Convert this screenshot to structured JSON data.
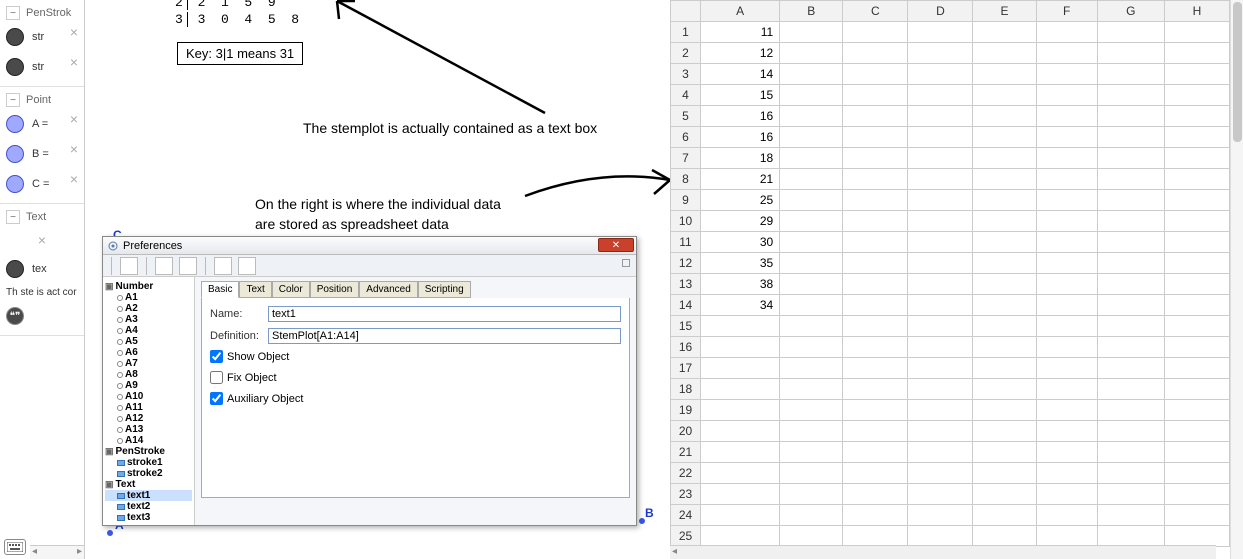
{
  "left_panel": {
    "sections": {
      "penstroke": {
        "label": "PenStrok"
      },
      "point": {
        "label": "Point"
      },
      "text": {
        "label": "Text"
      }
    },
    "items": {
      "stroke1": "str",
      "stroke2": "str",
      "pointA": "A =",
      "pointB": "B =",
      "pointC": "C =",
      "text1": "tex",
      "wrapped": "Th\nste\nis\nact\ncor"
    }
  },
  "canvas": {
    "stemplot": {
      "row2": "2  1  5  9",
      "row3": "3  0  4  5  8",
      "key": "Key: 3|1 means 31"
    },
    "annot1": "The stemplot is actually contained as a text box",
    "annot2_l1": "On the right is where the individual data",
    "annot2_l2": "are stored as spreadsheet data",
    "points": {
      "C": "C",
      "B": "B",
      "A": "A"
    }
  },
  "prefs": {
    "title": "Preferences",
    "tree": {
      "number": "Number",
      "numbers": [
        "A1",
        "A2",
        "A3",
        "A4",
        "A5",
        "A6",
        "A7",
        "A8",
        "A9",
        "A10",
        "A11",
        "A12",
        "A13",
        "A14"
      ],
      "penstroke": "PenStroke",
      "strokes": [
        "stroke1",
        "stroke2"
      ],
      "text": "Text",
      "texts": [
        "text1",
        "text2",
        "text3"
      ]
    },
    "tabs": [
      "Basic",
      "Text",
      "Color",
      "Position",
      "Advanced",
      "Scripting"
    ],
    "form": {
      "name_label": "Name:",
      "name_value": "text1",
      "def_label": "Definition:",
      "def_value": "StemPlot[A1:A14]",
      "show_obj": "Show Object",
      "fix_obj": "Fix Object",
      "aux_obj": "Auxiliary Object"
    }
  },
  "sheet": {
    "cols": [
      "A",
      "B",
      "C",
      "D",
      "E",
      "F",
      "G",
      "H"
    ],
    "rows": [
      1,
      2,
      3,
      4,
      5,
      6,
      7,
      8,
      9,
      10,
      11,
      12,
      13,
      14,
      15,
      16,
      17,
      18,
      19,
      20,
      21,
      22,
      23,
      24,
      25
    ],
    "data_A": [
      "11",
      "12",
      "14",
      "15",
      "16",
      "16",
      "18",
      "21",
      "25",
      "29",
      "30",
      "35",
      "38",
      "34"
    ]
  }
}
